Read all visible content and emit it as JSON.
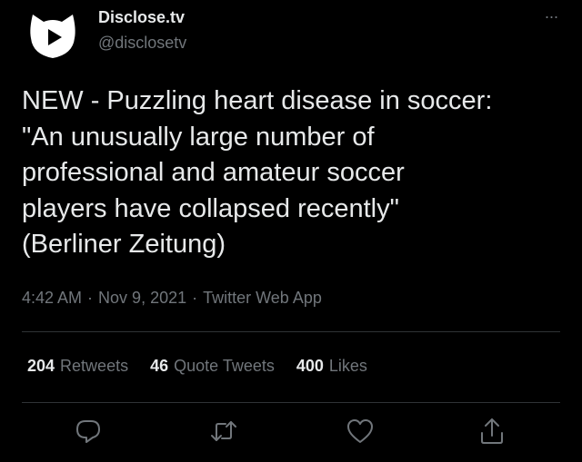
{
  "account": {
    "display_name": "Disclose.tv",
    "handle": "@disclosetv",
    "avatar_icon": "disclose-tv-logo"
  },
  "more_menu": {
    "label": "···"
  },
  "tweet": {
    "text": "NEW - Puzzling heart disease in soccer:\n\"An unusually large number of\nprofessional and amateur soccer\nplayers have collapsed recently\"\n(Berliner Zeitung)"
  },
  "meta": {
    "time": "4:42 AM",
    "separator": "·",
    "date": "Nov 9, 2021",
    "source": "Twitter Web App"
  },
  "stats": {
    "retweets": {
      "count": "204",
      "label": "Retweets"
    },
    "quotes": {
      "count": "46",
      "label": "Quote Tweets"
    },
    "likes": {
      "count": "400",
      "label": "Likes"
    }
  },
  "actions": {
    "reply_icon": "reply-icon",
    "retweet_icon": "retweet-icon",
    "like_icon": "heart-icon",
    "share_icon": "share-icon"
  },
  "colors": {
    "background": "#000000",
    "text_primary": "#e7e9ea",
    "text_secondary": "#71767b",
    "divider": "#2f3336"
  }
}
